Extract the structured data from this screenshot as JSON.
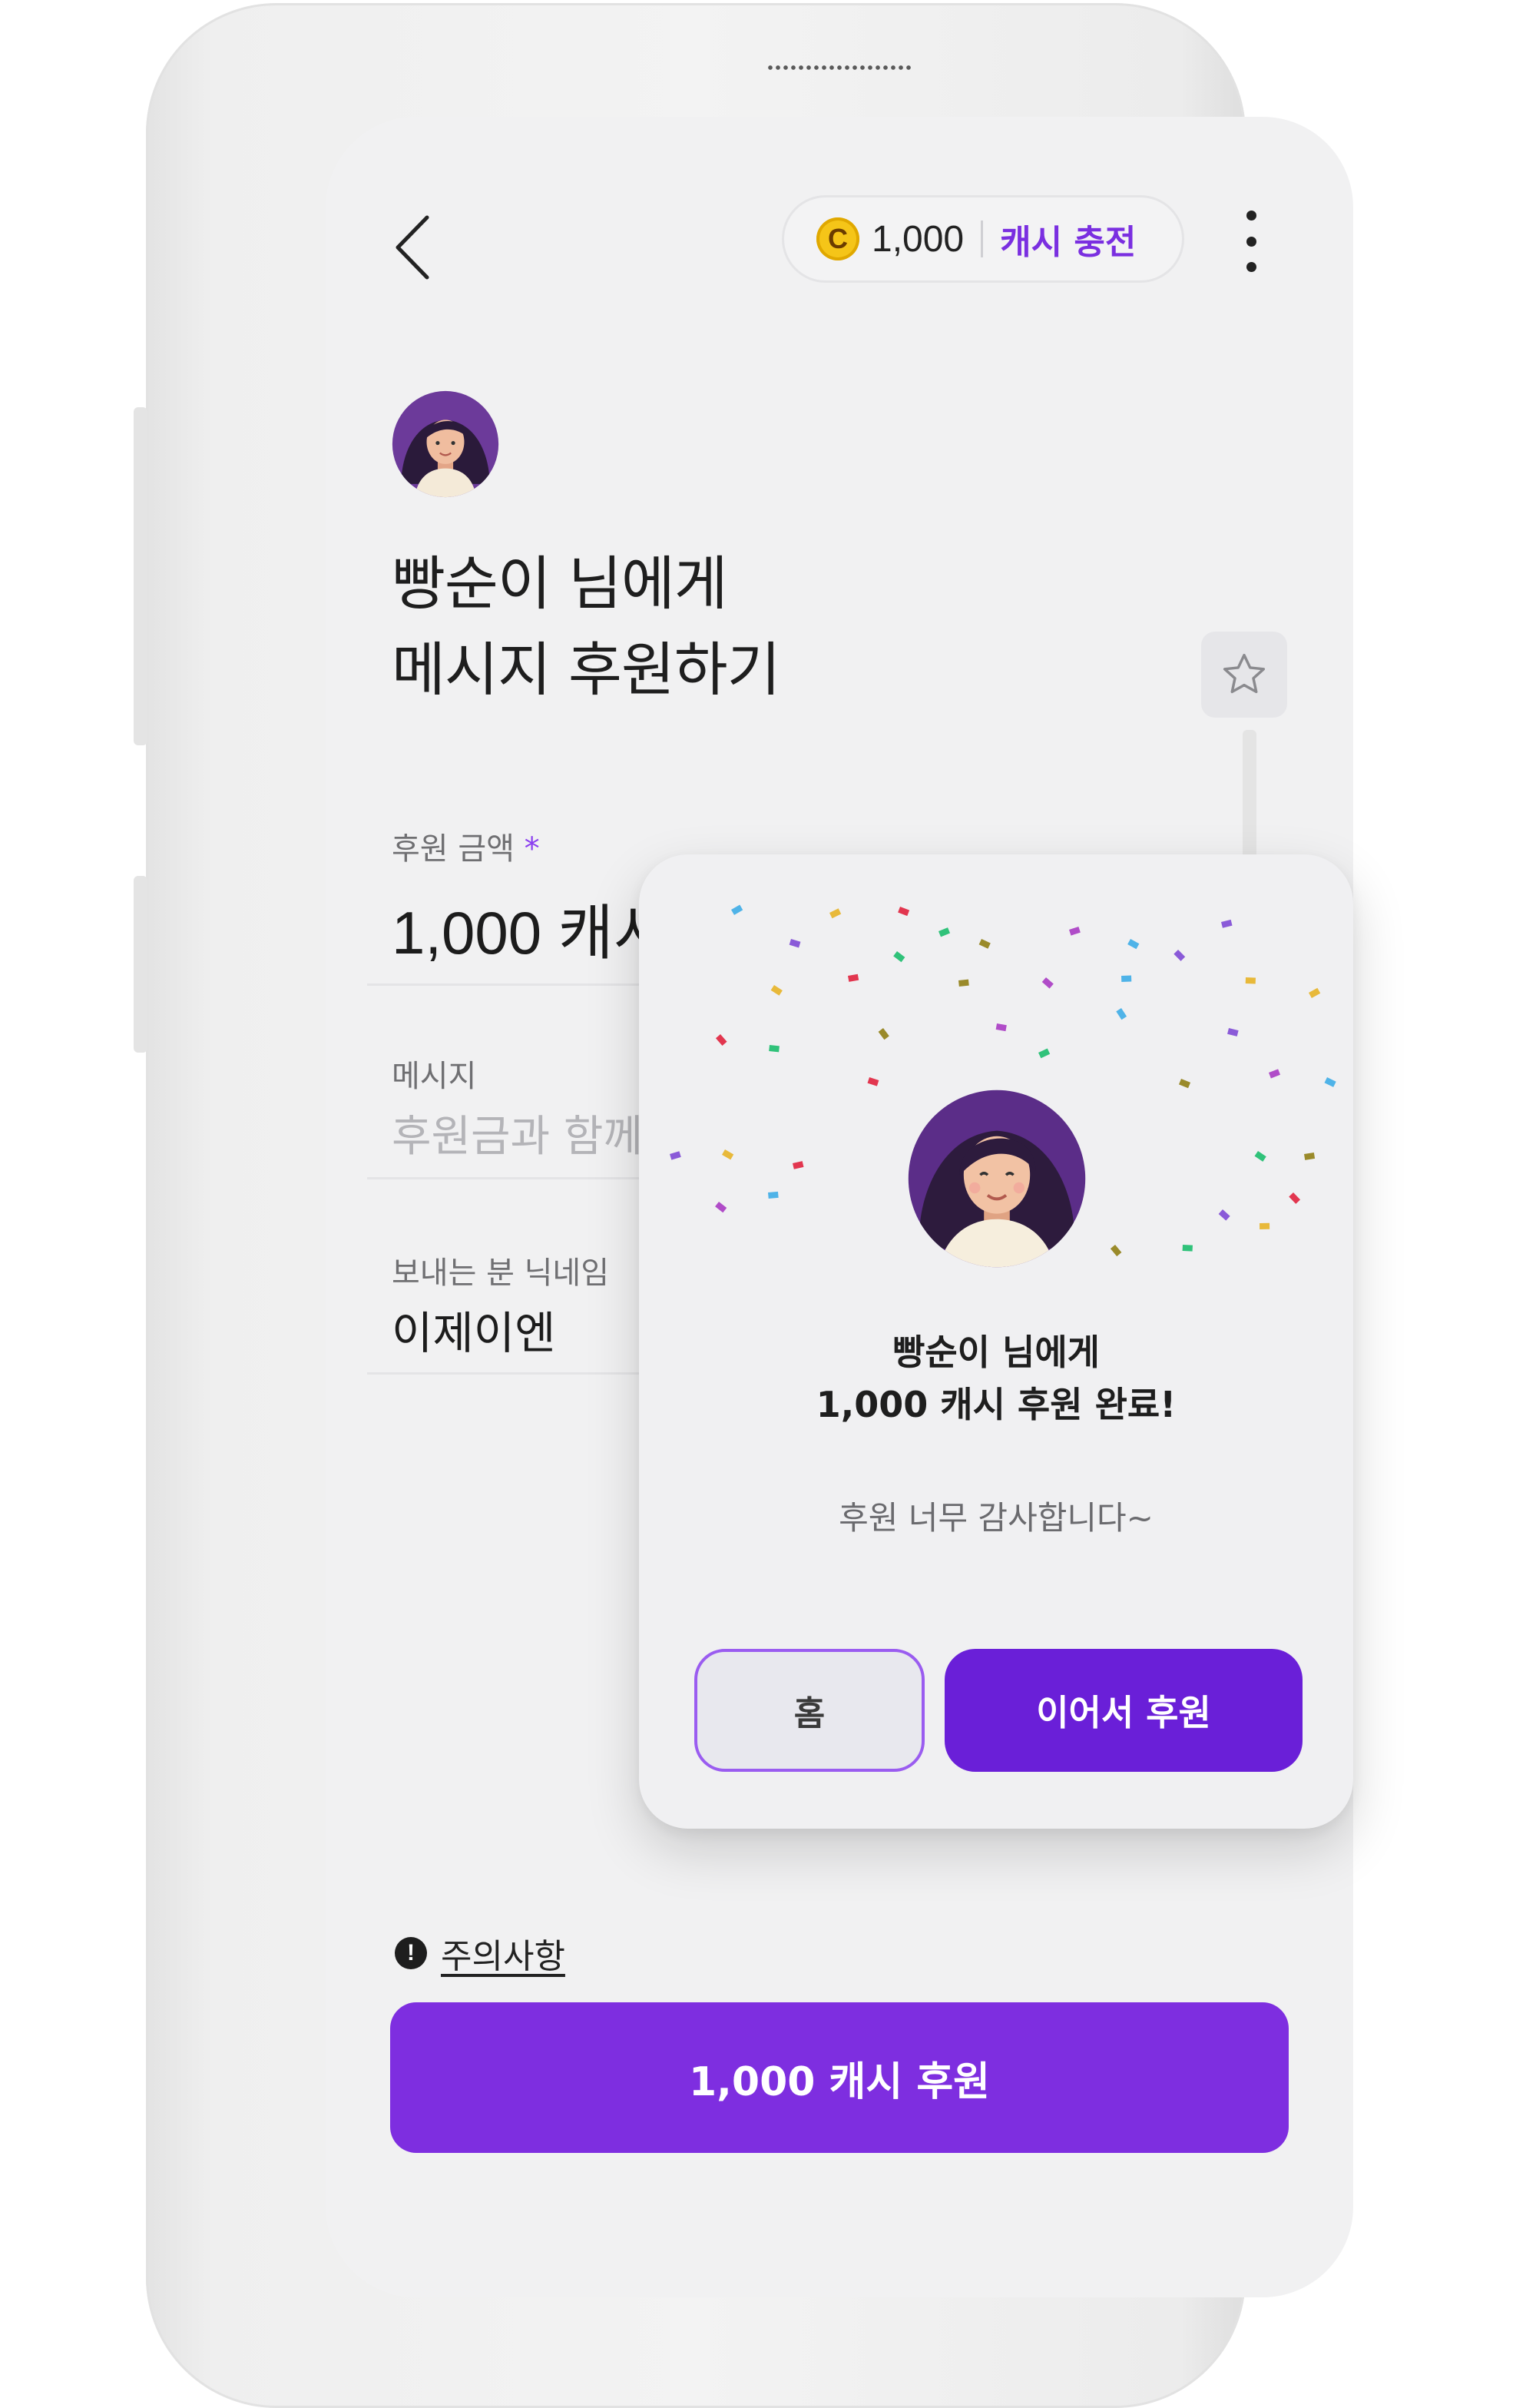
{
  "header": {
    "back_icon": "chevron-left-icon",
    "coin_symbol": "C",
    "balance": "1,000",
    "charge_label": "캐시 충전",
    "menu_icon": "more-vertical-icon"
  },
  "main": {
    "title_line1": "빵순이 님에게",
    "title_line2": "메시지 후원하기",
    "favorite_icon": "star-outline-icon",
    "amount_label": "후원 금액",
    "required_mark": "*",
    "amount_value": "1,000",
    "amount_unit": "캐시",
    "message_label": "메시지",
    "message_placeholder": "후원금과 함께 보낼 메",
    "nickname_label": "보내는 분 닉네임",
    "nickname_value": "이제이엔",
    "notice_icon": "!",
    "notice_label": "주의사항",
    "cta_label": "1,000 캐시 후원"
  },
  "popup": {
    "title_line1": "빵순이 님에게",
    "title_line2": "1,000 캐시 후원 완료!",
    "thanks": "후원 너무 감사합니다~",
    "home_label": "홈",
    "continue_label": "이어서 후원"
  },
  "colors": {
    "accent": "#7e2ee0",
    "accent_dark": "#6a1fd8",
    "coin": "#f5c518",
    "screen_bg": "#f1f1f2"
  }
}
